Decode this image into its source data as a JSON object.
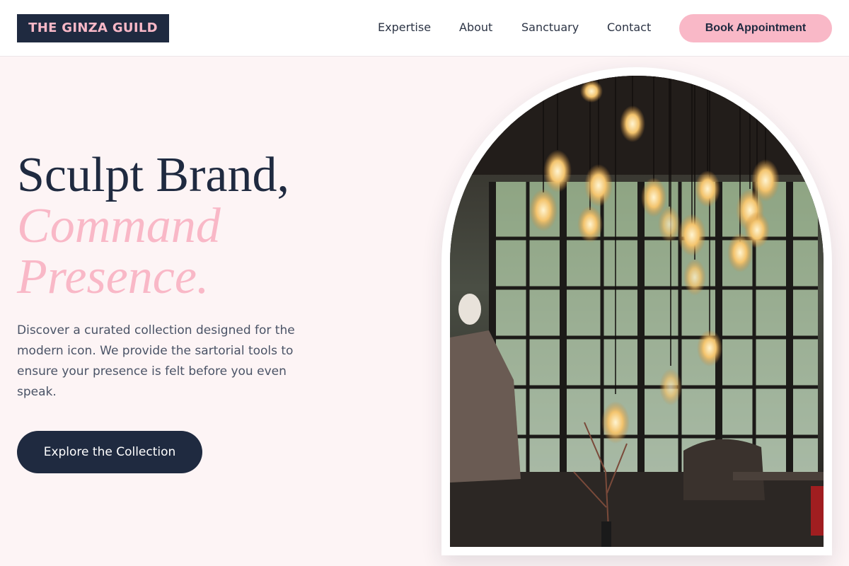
{
  "brand": {
    "logo_text": "THE GINZA GUILD"
  },
  "nav": {
    "links": [
      "Expertise",
      "About",
      "Sanctuary",
      "Contact"
    ],
    "cta_label": "Book Appointment"
  },
  "hero": {
    "headline_line1": "Sculpt Brand,",
    "headline_line2": "Command",
    "headline_line3": "Presence.",
    "description": "Discover a curated collection designed for the modern icon. We provide the sartorial tools to ensure your presence is felt before you even speak.",
    "cta_label": "Explore the Collection"
  },
  "colors": {
    "navy": "#1f2a40",
    "pink": "#f9b8c7",
    "background": "#fdf4f5"
  }
}
